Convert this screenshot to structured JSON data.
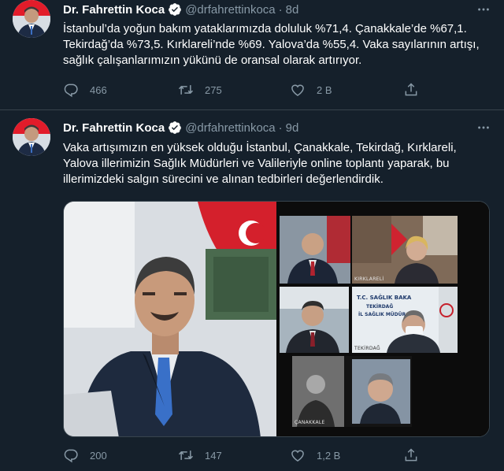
{
  "tweets": [
    {
      "author_name": "Dr. Fahrettin Koca",
      "handle": "@drfahrettinkoca",
      "separator": "·",
      "time": "8d",
      "text": "İstanbul’da yoğun bakım yataklarımızda doluluk %71,4. Çanakkale’de %67,1. Tekirdağ’da %73,5. Kırklareli’nde %69. Yalova’da %55,4. Vaka sayılarının artışı, sağlık çalışanlarımızın yükünü de oransal olarak artırıyor.",
      "replies": "466",
      "retweets": "275",
      "likes": "2 B",
      "icons": {
        "reply": "reply-icon",
        "retweet": "retweet-icon",
        "like": "heart-icon",
        "share": "share-icon",
        "verified": "verified-badge-icon",
        "more": "more-icon"
      }
    },
    {
      "author_name": "Dr. Fahrettin Koca",
      "handle": "@drfahrettinkoca",
      "separator": "·",
      "time": "9d",
      "text": "Vaka artışımızın en yüksek olduğu İstanbul, Çanakkale, Tekirdağ, Kırklareli, Yalova illerimizin Sağlık Müdürleri ve Valileriyle online toplantı yaparak, bu illerimizdeki salgın sürecini ve alınan tedbirleri değerlendirdik.",
      "replies": "200",
      "retweets": "147",
      "likes": "1,2 B",
      "media": {
        "labels": [
          "KIRKLARELİ",
          "TEKİRDAĞ",
          "ÇANAKKALE"
        ],
        "wall_sign_line1": "T.C. SAĞLIK BAKA",
        "wall_sign_line2": "TEKİRDAĞ",
        "wall_sign_line3": "İL SAĞLIK MÜDÜR"
      }
    }
  ],
  "colors": {
    "background": "#15202b",
    "divider": "#38444d",
    "secondary_text": "#8899a6",
    "verified": "#ffffff"
  }
}
